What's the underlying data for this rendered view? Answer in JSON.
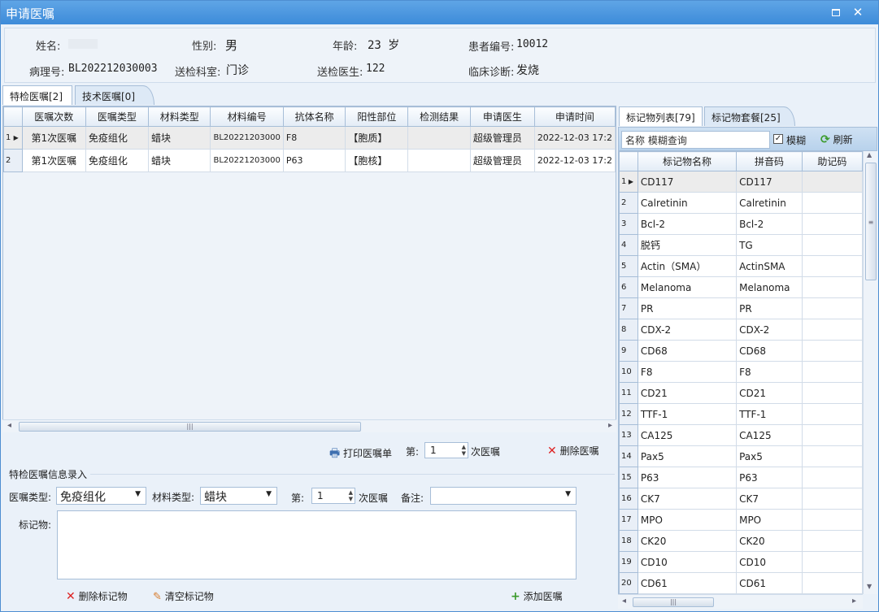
{
  "window": {
    "title": "申请医嘱"
  },
  "patient": {
    "name_label": "姓名:",
    "gender_label": "性别:",
    "gender": "男",
    "age_label": "年龄:",
    "age": "23 岁",
    "patient_no_label": "患者编号:",
    "patient_no": "10012",
    "pathology_no_label": "病理号:",
    "pathology_no": "BL202212030003",
    "dept_label": "送检科室:",
    "dept": "门诊",
    "doctor_label": "送检医生:",
    "doctor": "122",
    "diagnosis_label": "临床诊断:",
    "diagnosis": "发烧"
  },
  "left_tabs": [
    {
      "label": "特检医嘱[2]"
    },
    {
      "label": "技术医嘱[0]"
    }
  ],
  "orders": {
    "columns": [
      "医嘱次数",
      "医嘱类型",
      "材料类型",
      "材料编号",
      "抗体名称",
      "阳性部位",
      "检测结果",
      "申请医生",
      "申请时间"
    ],
    "rows": [
      {
        "no": "1",
        "times": "第1次医嘱",
        "type": "免疫组化",
        "material": "蜡块",
        "material_no": "BL20221203000",
        "antibody": "F8",
        "positive": "【胞质】",
        "result": "",
        "doctor": "超级管理员",
        "time": "2022-12-03 17:2"
      },
      {
        "no": "2",
        "times": "第1次医嘱",
        "type": "免疫组化",
        "material": "蜡块",
        "material_no": "BL20221203000",
        "antibody": "P63",
        "positive": "【胞核】",
        "result": "",
        "doctor": "超级管理员",
        "time": "2022-12-03 17:2"
      }
    ]
  },
  "order_toolbar": {
    "print_label": "打印医嘱单",
    "nth_label": "第:",
    "nth_value": "1",
    "times_label": "次医嘱",
    "delete_label": "删除医嘱"
  },
  "entry": {
    "section_title": "特检医嘱信息录入",
    "order_type_label": "医嘱类型:",
    "order_type": "免疫组化",
    "material_type_label": "材料类型:",
    "material_type": "蜡块",
    "nth_label": "第:",
    "nth_value": "1",
    "times_label": "次医嘱",
    "remark_label": "备注:",
    "remark": "",
    "marker_label": "标记物:",
    "delete_marker_label": "删除标记物",
    "clear_marker_label": "清空标记物",
    "add_order_label": "添加医嘱"
  },
  "right_tabs": [
    {
      "label": "标记物列表[79]"
    },
    {
      "label": "标记物套餐[25]"
    }
  ],
  "marker_search": {
    "placeholder": "名称 模糊查询",
    "fuzzy_label": "模糊",
    "refresh_label": "刷新"
  },
  "markers": {
    "columns": [
      "标记物名称",
      "拼音码",
      "助记码"
    ],
    "rows": [
      {
        "no": "1",
        "name": "CD117",
        "py": "CD117",
        "mn": ""
      },
      {
        "no": "2",
        "name": "Calretinin",
        "py": "Calretinin",
        "mn": ""
      },
      {
        "no": "3",
        "name": "Bcl-2",
        "py": "Bcl-2",
        "mn": ""
      },
      {
        "no": "4",
        "name": "脱钙",
        "py": "TG",
        "mn": ""
      },
      {
        "no": "5",
        "name": "Actin（SMA）",
        "py": "ActinSMA",
        "mn": ""
      },
      {
        "no": "6",
        "name": "Melanoma",
        "py": "Melanoma",
        "mn": ""
      },
      {
        "no": "7",
        "name": "PR",
        "py": "PR",
        "mn": ""
      },
      {
        "no": "8",
        "name": "CDX-2",
        "py": "CDX-2",
        "mn": ""
      },
      {
        "no": "9",
        "name": "CD68",
        "py": "CD68",
        "mn": ""
      },
      {
        "no": "10",
        "name": "F8",
        "py": "F8",
        "mn": ""
      },
      {
        "no": "11",
        "name": "CD21",
        "py": "CD21",
        "mn": ""
      },
      {
        "no": "12",
        "name": "TTF-1",
        "py": "TTF-1",
        "mn": ""
      },
      {
        "no": "13",
        "name": "CA125",
        "py": "CA125",
        "mn": ""
      },
      {
        "no": "14",
        "name": "Pax5",
        "py": "Pax5",
        "mn": ""
      },
      {
        "no": "15",
        "name": "P63",
        "py": "P63",
        "mn": ""
      },
      {
        "no": "16",
        "name": "CK7",
        "py": "CK7",
        "mn": ""
      },
      {
        "no": "17",
        "name": "MPO",
        "py": "MPO",
        "mn": ""
      },
      {
        "no": "18",
        "name": "CK20",
        "py": "CK20",
        "mn": ""
      },
      {
        "no": "19",
        "name": "CD10",
        "py": "CD10",
        "mn": ""
      },
      {
        "no": "20",
        "name": "CD61",
        "py": "CD61",
        "mn": ""
      }
    ]
  }
}
